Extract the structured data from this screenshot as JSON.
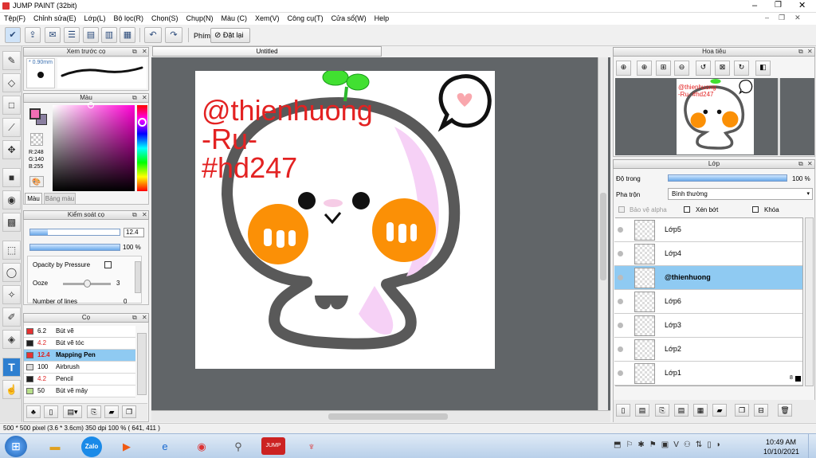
{
  "window": {
    "title": "JUMP PAINT (32bit)"
  },
  "menu": [
    "Tệp(F)",
    "Chỉnh sửa(E)",
    "Lớp(L)",
    "Bộ lọc(R)",
    "Chọn(S)",
    "Chụp(N)",
    "Màu (C)",
    "Xem(V)",
    "Công cụ(T)",
    "Cửa sổ(W)",
    "Help"
  ],
  "toolbar": {
    "key_label": "Phím",
    "reset_label": "Đặt lại"
  },
  "brush_preview": {
    "title": "Xem trước cọ",
    "size": "* 0.90mm"
  },
  "color_panel": {
    "title": "Màu",
    "r": "R:248",
    "g": "G:140",
    "b": "B:255",
    "tab_color": "Màu",
    "tab_palette": "Bảng màu",
    "fg": "#f06eb4",
    "bg": "#8a7fa0"
  },
  "brush_control": {
    "title": "Kiểm soát cọ",
    "size_value": "12.4",
    "size_pct": 0.2,
    "opacity_value": "100 %",
    "opacity_pct": 1.0,
    "pressure_label": "Opacity by Pressure",
    "ooze_label": "Ooze",
    "ooze_value": "3",
    "next_label": "Number of lines",
    "next_value": "0"
  },
  "brush_list": {
    "title": "Cọ",
    "items": [
      {
        "size": "6.2",
        "name": "Bút vẽ",
        "color": "#e63232",
        "selected": false,
        "red": false
      },
      {
        "size": "4.2",
        "name": "Bút vẽ tóc",
        "color": "#222222",
        "selected": false,
        "red": true
      },
      {
        "size": "12.4",
        "name": "Mapping Pen",
        "color": "#e63232",
        "selected": true,
        "red": true
      },
      {
        "size": "100",
        "name": "Airbrush",
        "color": "#dddddd",
        "selected": false,
        "red": false
      },
      {
        "size": "4.2",
        "name": "Pencil",
        "color": "#222222",
        "selected": false,
        "red": true
      },
      {
        "size": "50",
        "name": "Bút vẽ mây",
        "color": "#b8e08a",
        "selected": false,
        "red": false
      }
    ]
  },
  "document": {
    "tab": "Untitled"
  },
  "canvas_text": {
    "line1": "@thienhuong",
    "line2": "-Ru-",
    "line3": "#hd247"
  },
  "navigator": {
    "title": "Hoa tiêu",
    "thumb_text": "@thienhuong -Ru- #hd247"
  },
  "layer_panel": {
    "title": "Lớp",
    "opacity_label": "Độ trong",
    "opacity_value": "100 %",
    "opacity_pct": 1.0,
    "blend_label": "Pha trộn",
    "blend_value": "Bình thường",
    "protect_alpha": "Bảo vệ alpha",
    "clip": "Xén bớt",
    "lock": "Khóa",
    "layers": [
      {
        "name": "Lớp5",
        "selected": false
      },
      {
        "name": "Lớp4",
        "selected": false
      },
      {
        "name": "@thienhuong",
        "selected": true
      },
      {
        "name": "Lớp6",
        "selected": false
      },
      {
        "name": "Lớp3",
        "selected": false
      },
      {
        "name": "Lớp2",
        "selected": false
      },
      {
        "name": "Lớp1",
        "selected": false
      }
    ],
    "layer1_badge": "8"
  },
  "status": {
    "text": "500 * 500 pixel   (3.6 * 3.6cm)   350 dpi   100 %   ( 641, 411 )"
  },
  "taskbar": {
    "time": "10:49 AM",
    "date": "10/10/2021",
    "zalo": "Zalo"
  }
}
